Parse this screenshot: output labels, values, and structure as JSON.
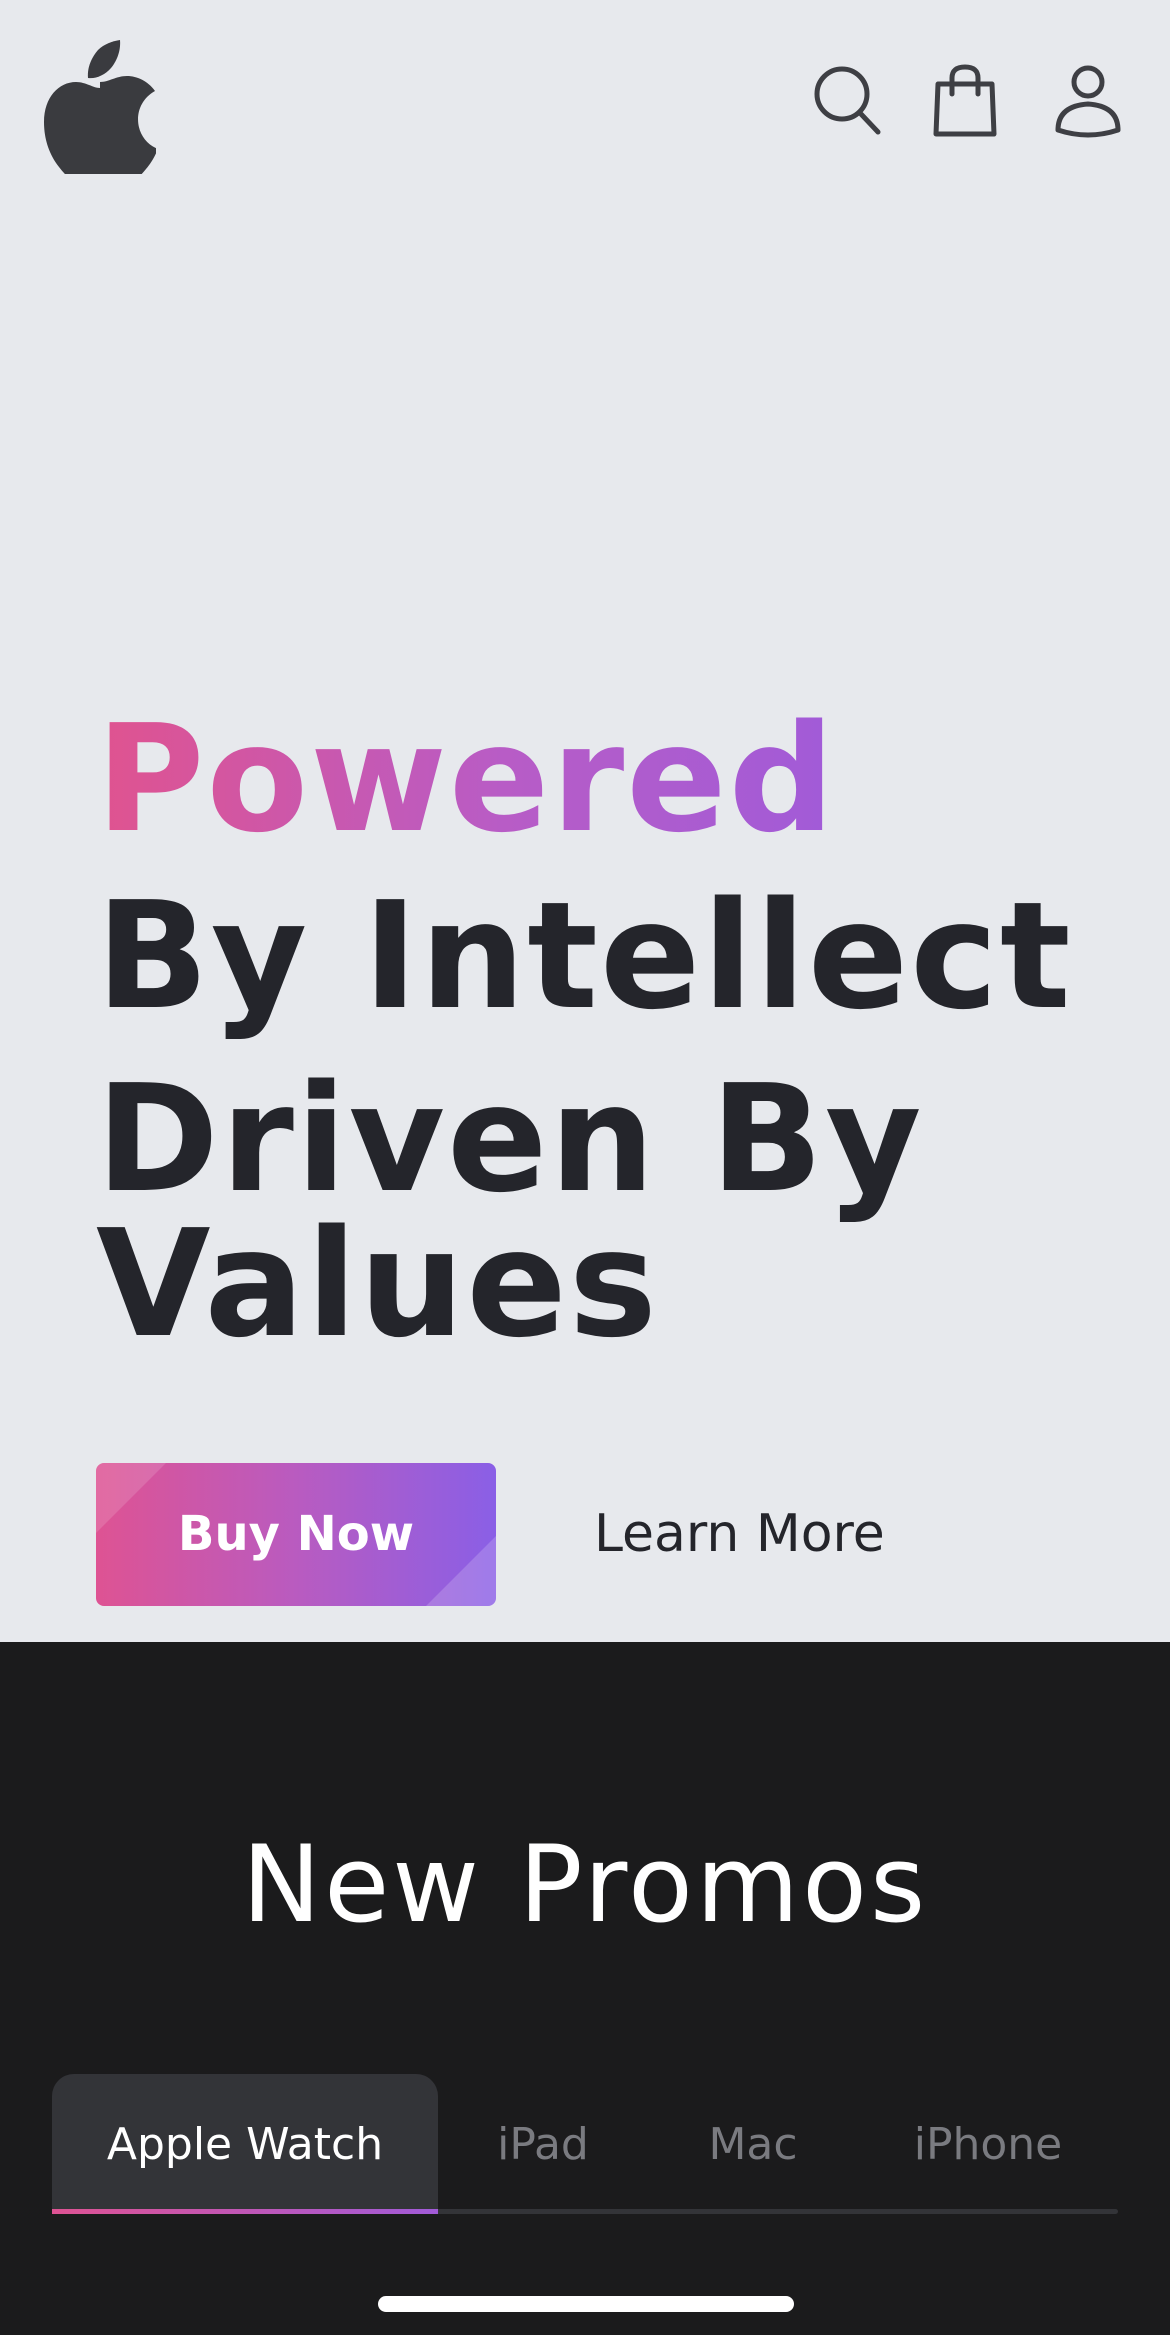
{
  "header": {
    "logo_icon": "apple-logo-icon",
    "icons": [
      "search-icon",
      "shopping-bag-icon",
      "user-icon"
    ],
    "icon_color": "#3e3f44"
  },
  "hero": {
    "line1": "Powered",
    "line2": "By Intellect",
    "line3": "Driven By",
    "line4": "Values",
    "buy_label": "Buy Now",
    "learn_label": "Learn More",
    "accent_gradient": [
      "#e0538f",
      "#8a5fe6"
    ],
    "background": "#e7e9ed",
    "text_color": "#24252b"
  },
  "promos": {
    "title": "New Promos",
    "background": "#1b1b1c",
    "tabs": [
      {
        "label": "Apple Watch",
        "active": true
      },
      {
        "label": "iPad",
        "active": false
      },
      {
        "label": "Mac",
        "active": false
      },
      {
        "label": "iPhone",
        "active": false
      }
    ]
  }
}
